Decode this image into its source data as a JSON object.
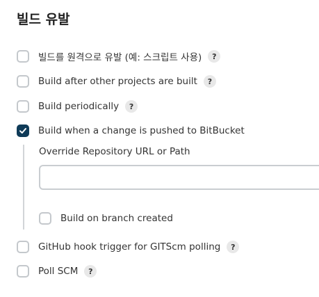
{
  "section_title": "빌드 유발",
  "triggers": [
    {
      "label": "빌드를 원격으로 유발 (예: 스크립트 사용)",
      "checked": false,
      "help": "?"
    },
    {
      "label": "Build after other projects are built",
      "checked": false,
      "help": "?"
    },
    {
      "label": "Build periodically",
      "checked": false,
      "help": "?"
    },
    {
      "label": "Build when a change is pushed to BitBucket",
      "checked": true
    },
    {
      "label": "GitHub hook trigger for GITScm polling",
      "checked": false,
      "help": "?"
    },
    {
      "label": "Poll SCM",
      "checked": false,
      "help": "?"
    }
  ],
  "bitbucket_options": {
    "override_label": "Override Repository URL or Path",
    "override_value": "",
    "branch_created_label": "Build on branch created",
    "branch_created_checked": false
  }
}
